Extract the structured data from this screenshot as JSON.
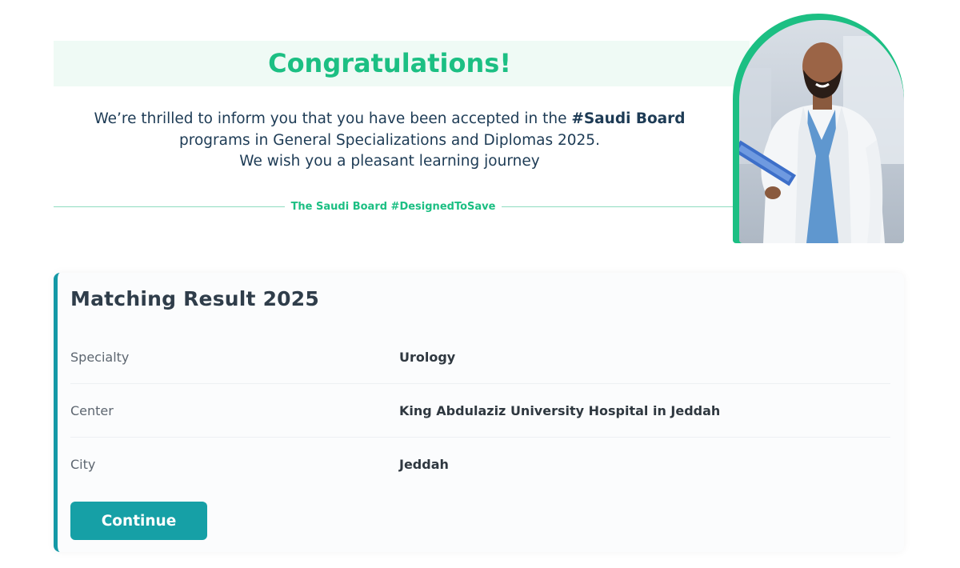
{
  "banner": {
    "title": "Congratulations!",
    "message_line1_prefix": "We’re thrilled to inform you that you have been accepted in the ",
    "message_line1_bold": "#Saudi Board",
    "message_line2": "programs in General Specializations and Diplomas 2025.",
    "message_line3": "We wish you a pleasant learning journey",
    "tagline": "The Saudi Board #DesignedToSave"
  },
  "result": {
    "title": "Matching Result 2025",
    "rows": [
      {
        "label": "Specialty",
        "value": "Urology"
      },
      {
        "label": "Center",
        "value": "King Abdulaziz University Hospital in Jeddah"
      },
      {
        "label": "City",
        "value": "Jeddah"
      }
    ],
    "continue_label": "Continue"
  },
  "colors": {
    "accent_green": "#1cbf83",
    "accent_teal": "#1499a6",
    "text_navy": "#1d3b55"
  }
}
